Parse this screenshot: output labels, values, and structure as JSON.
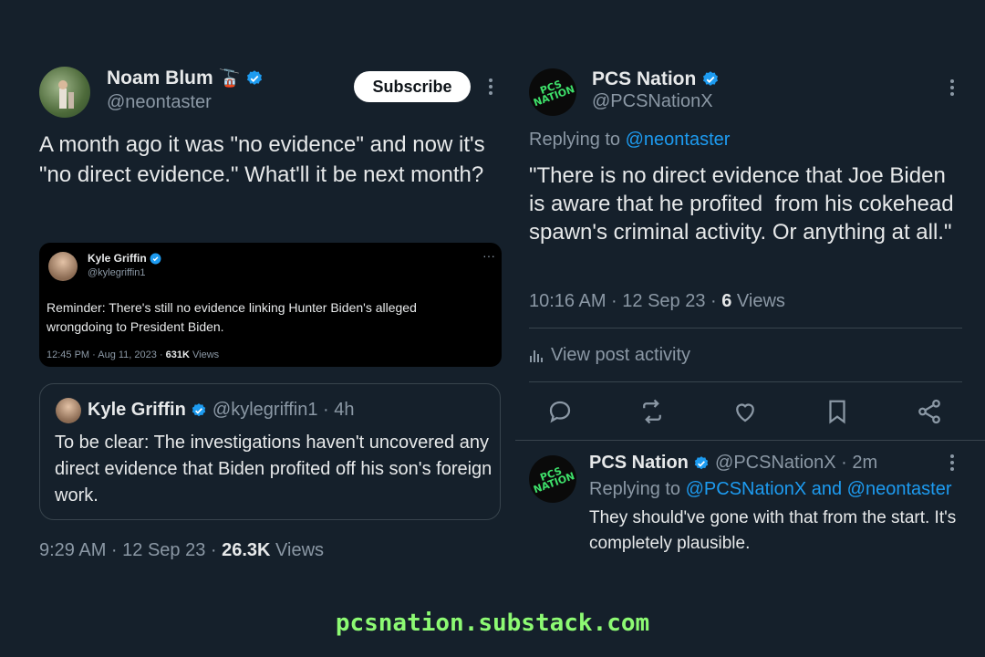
{
  "left_tweet": {
    "author_name": "Noam Blum",
    "author_emoji": "🚡",
    "handle": "@neontaster",
    "subscribe_label": "Subscribe",
    "body": "A month ago it was \"no evidence\" and now it's \"no direct evidence.\" What'll it be next month?",
    "timestamp": "9:29 AM · 12 Sep 23 · ",
    "views_count": "26.3K",
    "views_label": " Views"
  },
  "embedded_screenshot": {
    "author_name": "Kyle Griffin",
    "handle": "@kylegriffin1",
    "body": "Reminder: There's still no evidence linking Hunter Biden's alleged wrongdoing to President Biden.",
    "timestamp": "12:45 PM · Aug 11, 2023 · ",
    "views_count": "631K",
    "views_label": " Views"
  },
  "quoted_tweet": {
    "author_name": "Kyle Griffin",
    "handle_time": "@kylegriffin1 · 4h",
    "body": "To be clear: The investigations haven't uncovered any direct evidence that Biden profited off his son's foreign work."
  },
  "right_tweet": {
    "author_name": "PCS Nation",
    "handle": "@PCSNationX",
    "avatar_text": "PCS NATION",
    "replying_prefix": "Replying to ",
    "replying_to": "@neontaster",
    "body": "\"There is no direct evidence that Joe Biden is aware that he profited  from his cokehead spawn's criminal activity. Or anything at all.\"",
    "timestamp": "10:16 AM · 12 Sep 23 · ",
    "views_count": "6",
    "views_label": " Views",
    "view_activity": "View post activity"
  },
  "reply_tweet": {
    "author_name": "PCS Nation",
    "handle_time": "@PCSNationX · 2m",
    "replying_prefix": "Replying to ",
    "replying_to": "@PCSNationX and @neontaster",
    "body": "They should've gone with that from the start. It's completely plausible."
  },
  "footer": {
    "url": "pcsnation.substack.com"
  },
  "colors": {
    "background": "#15202b",
    "accent": "#1d9bf0",
    "footer_green": "#8dfa73"
  }
}
